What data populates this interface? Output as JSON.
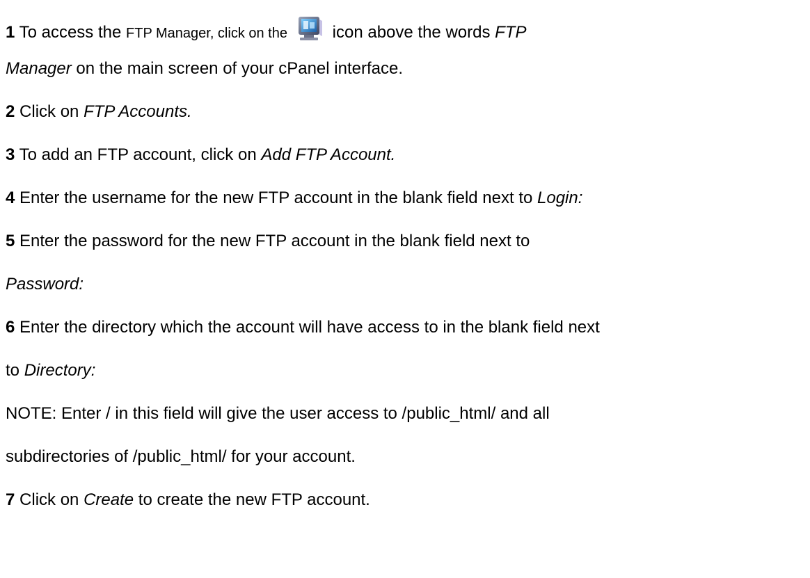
{
  "steps": [
    {
      "num": "1",
      "a": "To access the",
      "b": "FTP Manager, click on the",
      "c": "icon above the words",
      "d": "FTP",
      "e": "Manager",
      "f": "on the main screen of your cPanel interface."
    },
    {
      "num": "2",
      "a": "Click on",
      "b": "FTP Accounts."
    },
    {
      "num": "3",
      "a": "To add an FTP account, click on",
      "b": "Add FTP Account."
    },
    {
      "num": "4",
      "a": "Enter the username for the new FTP account in the blank field next to",
      "b": "Login:"
    },
    {
      "num": "5",
      "a": "Enter the password for the new FTP account in the blank field next to",
      "b": "Password:"
    },
    {
      "num": "6",
      "a": "Enter the directory which the account will have access to in the blank field next",
      "b": "to",
      "c": "Directory:"
    },
    {
      "num": "7",
      "a": "Click on",
      "b": "Create",
      "c": "to create the new FTP account."
    }
  ],
  "note": {
    "line1": "NOTE: Enter / in this field will give the user access to /public_html/ and all",
    "line2": "subdirectories of /public_html/ for your account."
  },
  "icon": "ftp-manager-monitor-icon"
}
